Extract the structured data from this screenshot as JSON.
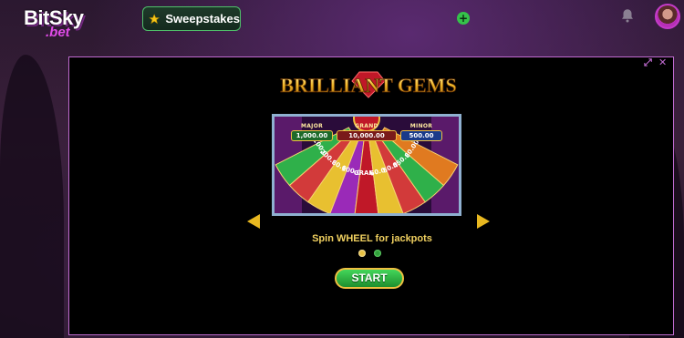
{
  "header": {
    "logo_text": "BitSky",
    "logo_sub": ".bet",
    "sweepstakes_label": "Sweepstakes",
    "icons": [
      "star-icon",
      "plus-icon",
      "bell-icon",
      "avatar"
    ]
  },
  "game": {
    "title": "BRILLIANT GEMS",
    "jackpots": [
      {
        "label": "MAJOR",
        "value": "1,000.00"
      },
      {
        "label": "GRAND",
        "value": "10,000.00"
      },
      {
        "label": "MINOR",
        "value": "500.00"
      }
    ],
    "wheel_segments": [
      "100.00",
      "200.00",
      "80.00",
      "100.00",
      "GRAND",
      "60.00",
      "50.00",
      "450.00",
      "80.00"
    ],
    "caption": "Spin WHEEL for jackpots",
    "start_label": "START",
    "page_dots": 2
  },
  "colors": {
    "accent_purple": "#c06bd0",
    "gold": "#e8b820",
    "start_green": "#2fae44"
  }
}
